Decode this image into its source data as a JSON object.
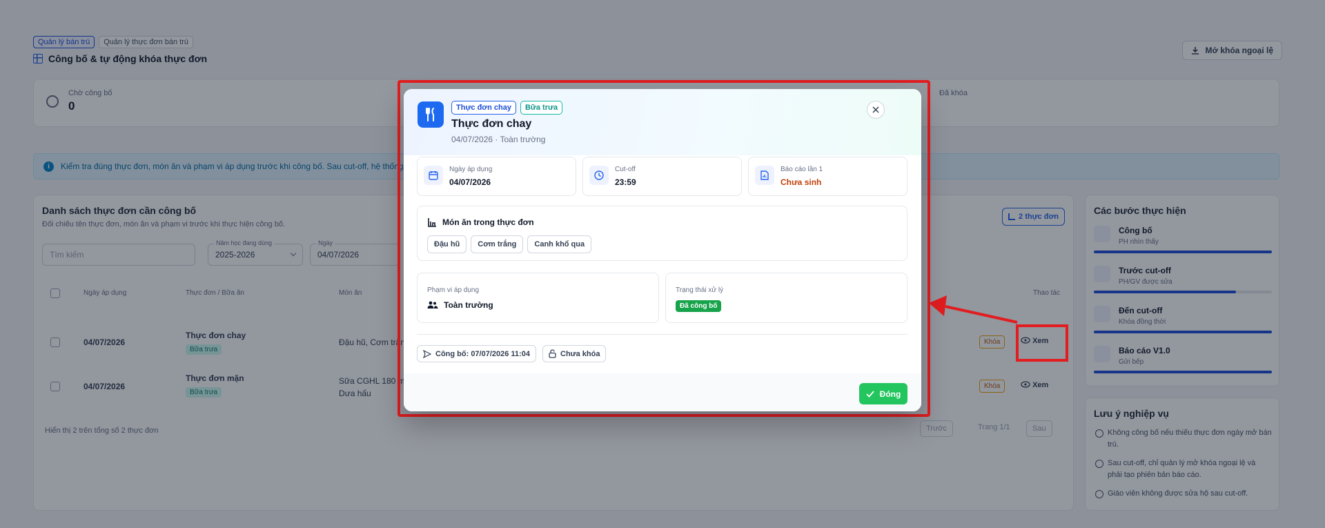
{
  "header": {
    "breadcrumbs": [
      "Quản lý bán trú",
      "Quản lý thực đơn bán trú"
    ],
    "title": "Công bố & tự động khóa thực đơn",
    "unlock_label": "Mở khóa ngoại lệ"
  },
  "stats": {
    "pending_label": "Chờ công bố",
    "pending_value": "0",
    "right_label": "Đã khóa"
  },
  "info_text": "Kiểm tra đúng thực đơn, món ăn và phạm vi áp dụng trước khi công bố. Sau cut-off, hệ thống tự động khóa thực đơn.",
  "list": {
    "title": "Danh sách thực đơn cần công bố",
    "subtitle": "Đối chiếu tên thực đơn, món ăn và phạm vi trước khi thực hiện công bố.",
    "count_label": "2 thực đơn",
    "search_placeholder": "Tìm kiếm",
    "year_label": "Năm học đang dùng",
    "year_value": "2025-2026",
    "date_label": "Ngày",
    "date_value": "04/07/2026",
    "columns": [
      "Ngày áp dụng",
      "Thực đơn / Bữa ăn",
      "Món ăn",
      "Thao tác"
    ],
    "rows": [
      {
        "date": "04/07/2026",
        "menu": "Thực đơn chay",
        "meal": "Bữa trưa",
        "dishes": "Đậu hũ, Cơm trắng, Canh khổ qua",
        "dishes2": "",
        "lock": "Khóa",
        "view": "Xem"
      },
      {
        "date": "04/07/2026",
        "menu": "Thực đơn mặn",
        "meal": "Bữa trưa",
        "dishes": "Sữa CGHL 180 ml",
        "dishes2": "Dưa hấu",
        "lock": "Khóa",
        "view": "Xem"
      }
    ],
    "footer_text": "Hiển thị 2 trên tổng số 2 thực đơn",
    "prev_label": "Trước",
    "page_label": "Trang 1/1",
    "next_label": "Sau"
  },
  "steps": {
    "title": "Các bước thực hiện",
    "items": [
      {
        "title": "Công bố",
        "sub": "PH nhìn thấy",
        "progress": 1.0
      },
      {
        "title": "Trước cut-off",
        "sub": "PH/GV được sửa",
        "progress": 0.8
      },
      {
        "title": "Đến cut-off",
        "sub": "Khóa đồng thời",
        "progress": 1.0
      },
      {
        "title": "Báo cáo V1.0",
        "sub": "Gửi bếp",
        "progress": 1.0
      }
    ]
  },
  "notes": {
    "title": "Lưu ý nghiệp vụ",
    "items": [
      "Không công bố nếu thiếu thực đơn ngày mở bán trú.",
      "Sau cut-off, chỉ quản lý mở khóa ngoại lệ và phải tạo phiên bản báo cáo.",
      "Giáo viên không được sửa hộ sau cut-off."
    ]
  },
  "modal": {
    "tags": [
      "Thực đơn chay",
      "Bữa trưa"
    ],
    "title": "Thực đơn chay",
    "subtitle": "04/07/2026 · Toàn trường",
    "apply_date_label": "Ngày áp dụng",
    "apply_date_value": "04/07/2026",
    "cutoff_label": "Cut-off",
    "cutoff_value": "23:59",
    "report_label": "Báo cáo lần 1",
    "report_value": "Chưa sinh",
    "dishes_title": "Món ăn trong thực đơn",
    "dishes": [
      "Đậu hũ",
      "Cơm trắng",
      "Canh khổ qua"
    ],
    "scope_label": "Phạm vi áp dụng",
    "scope_value": "Toàn trường",
    "status_label": "Trạng thái xử lý",
    "status_value": "Đã công bố",
    "published_label": "Công bố: 07/07/2026 11:04",
    "lock_label": "Chưa khóa",
    "close_label": "Đóng"
  },
  "colors": {
    "primary": "#1d6af0",
    "success": "#22c55e",
    "annotation": "#e11d20",
    "warning": "#c2410c"
  }
}
